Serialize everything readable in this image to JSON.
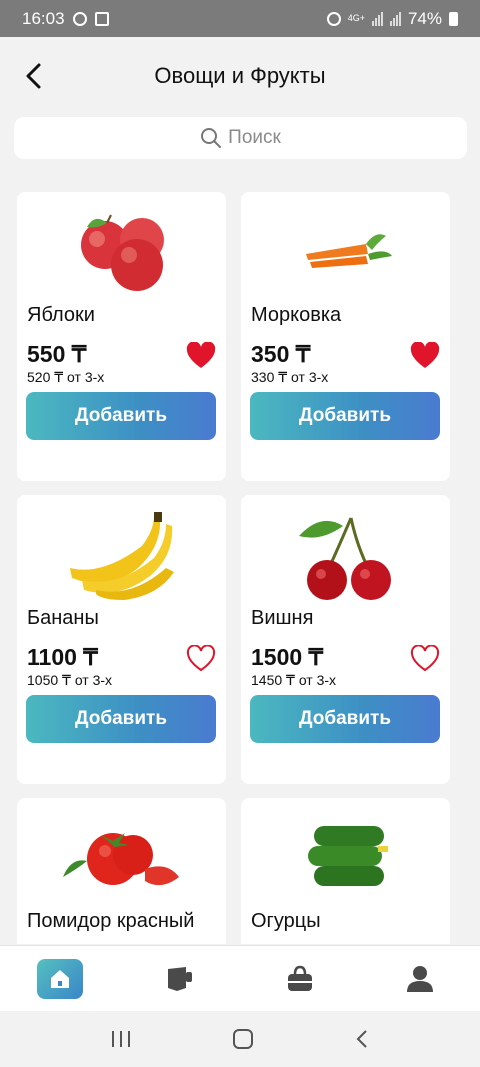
{
  "status": {
    "time": "16:03",
    "network": "4G+",
    "battery": "74%"
  },
  "header": {
    "title": "Овощи и Фрукты"
  },
  "search": {
    "placeholder": "Поиск"
  },
  "products": [
    {
      "name": "Яблоки",
      "price": "550 ₸",
      "bulk": "520 ₸ от 3-х",
      "favorite": true,
      "button": "Добавить"
    },
    {
      "name": "Морковка",
      "price": "350 ₸",
      "bulk": "330 ₸ от 3-х",
      "favorite": true,
      "button": "Добавить"
    },
    {
      "name": "Бананы",
      "price": "1100 ₸",
      "bulk": "1050 ₸ от 3-х",
      "favorite": false,
      "button": "Добавить"
    },
    {
      "name": "Вишня",
      "price": "1500 ₸",
      "bulk": "1450 ₸ от 3-х",
      "favorite": false,
      "button": "Добавить"
    },
    {
      "name": "Помидор красный"
    },
    {
      "name": "Огурцы"
    }
  ],
  "bottom_nav": [
    "home-icon",
    "catalog-icon",
    "bag-icon",
    "profile-icon"
  ],
  "colors": {
    "accent_start": "#4bb8c0",
    "accent_end": "#4a7bd0",
    "heart": "#e0142a"
  }
}
